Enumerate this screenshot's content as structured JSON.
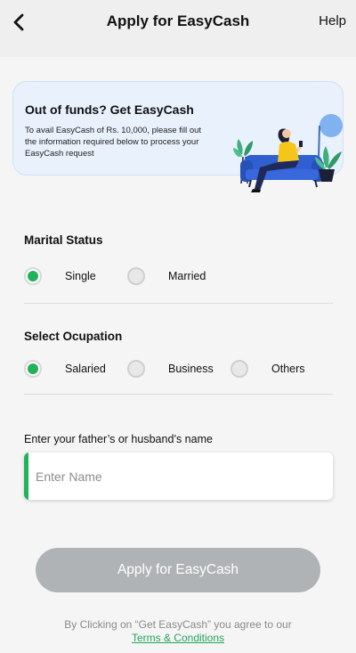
{
  "header": {
    "title": "Apply for EasyCash",
    "help_label": "Help"
  },
  "banner": {
    "title": "Out of funds? Get EasyCash",
    "description": "To avail EasyCash of Rs. 10,000, please fill out the information required below to process your EasyCash request"
  },
  "marital": {
    "label": "Marital Status",
    "options": [
      {
        "label": "Single",
        "selected": true
      },
      {
        "label": "Married",
        "selected": false
      }
    ]
  },
  "occupation": {
    "label": "Select Ocupation",
    "options": [
      {
        "label": "Salaried",
        "selected": true
      },
      {
        "label": "Business",
        "selected": false
      },
      {
        "label": "Others",
        "selected": false
      }
    ]
  },
  "name_field": {
    "label": "Enter your father’s or husband’s name",
    "placeholder": "Enter Name",
    "value": ""
  },
  "apply_button": {
    "label": "Apply for EasyCash"
  },
  "terms": {
    "text": "By Clicking on “Get EasyCash” you agree to our",
    "link_label": "Terms & Conditions"
  },
  "colors": {
    "accent": "#23b25c",
    "button_disabled": "#b0b3b5",
    "banner_bg": "#e9f1fd"
  },
  "icons": {
    "back": "chevron-left-icon"
  }
}
